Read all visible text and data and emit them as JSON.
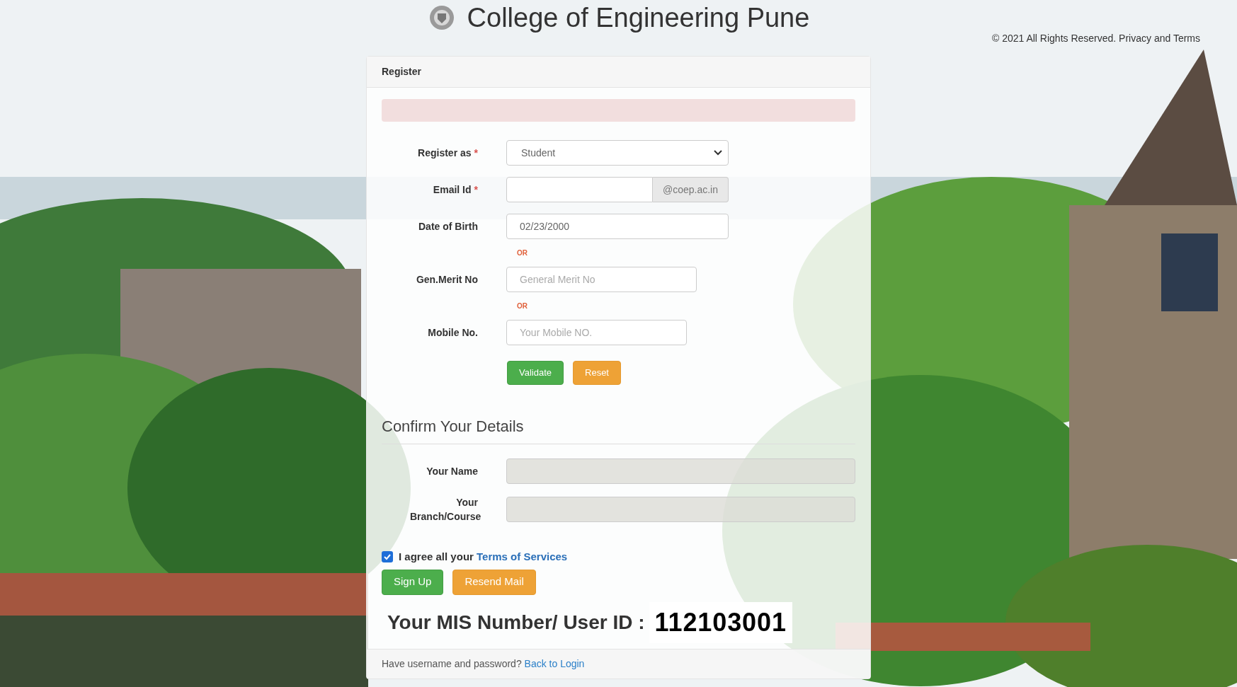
{
  "header": {
    "title": "College of Engineering Pune",
    "copyright": "© 2021 All Rights Reserved. Privacy and Terms"
  },
  "card": {
    "title": "Register",
    "fields": [
      {
        "kind": "select",
        "label": "Register as",
        "required_mark": "*",
        "value": "Student"
      },
      {
        "kind": "addon",
        "label": "Email Id",
        "required_mark": "*",
        "addon": "@coep.ac.in"
      },
      {
        "kind": "text",
        "label": "Date of Birth",
        "value": "02/23/2000"
      },
      {
        "kind": "separator",
        "text": "OR"
      },
      {
        "kind": "text",
        "label": "Gen.Merit No",
        "placeholder": "General Merit No"
      },
      {
        "kind": "separator",
        "text": "OR"
      },
      {
        "kind": "text",
        "label": "Mobile No.",
        "placeholder": "Your Mobile NO."
      }
    ],
    "buttons": [
      {
        "label": "Validate",
        "kind": "success"
      },
      {
        "label": "Reset",
        "kind": "warning"
      }
    ],
    "confirm": {
      "heading": "Confirm Your Details",
      "fields": [
        {
          "label": "Your Name",
          "disabled": true
        },
        {
          "label": "Your Branch/Course",
          "disabled": true
        }
      ]
    },
    "agree": {
      "checked": true,
      "text": "I agree all your",
      "link": "Terms of Services"
    },
    "actions": [
      {
        "label": "Sign Up",
        "kind": "success"
      },
      {
        "label": "Resend Mail",
        "kind": "warning"
      }
    ],
    "mis": {
      "label": "Your MIS Number/ User ID :",
      "value": "112103001"
    },
    "footer": {
      "text": "Have username and password?",
      "link": "Back to Login"
    }
  }
}
